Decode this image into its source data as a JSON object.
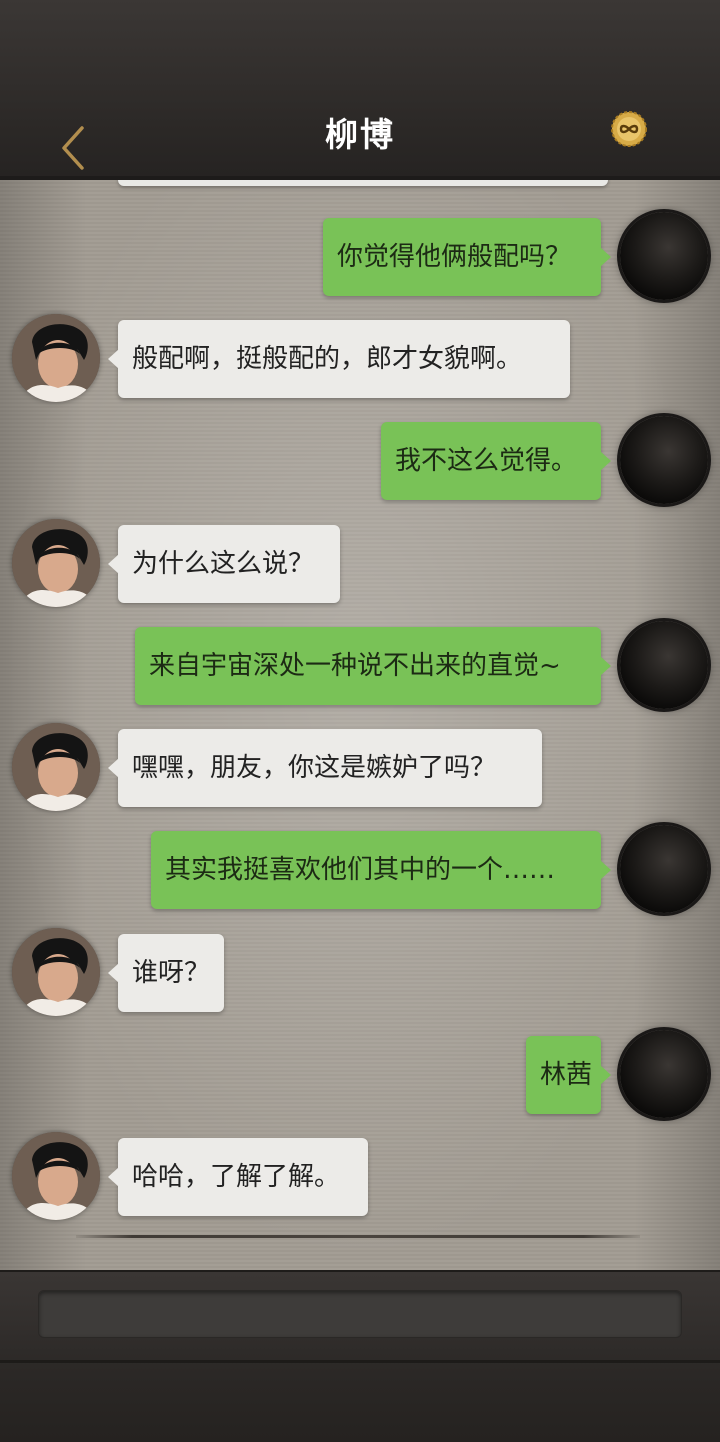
{
  "header": {
    "title": "柳博",
    "back_icon": "chevron-left-icon",
    "coin_icon": "infinity-coin-icon",
    "accent_color": "#c9a24b"
  },
  "chat": {
    "messages": [
      {
        "sender": "me",
        "text": "你觉得他俩般配吗？"
      },
      {
        "sender": "them",
        "text": "般配啊，挺般配的，郎才女貌啊。"
      },
      {
        "sender": "me",
        "text": "我不这么觉得。"
      },
      {
        "sender": "them",
        "text": "为什么这么说？"
      },
      {
        "sender": "me",
        "text": "来自宇宙深处一种说不出来的直觉~"
      },
      {
        "sender": "them",
        "text": "嘿嘿，朋友，你这是嫉妒了吗？"
      },
      {
        "sender": "me",
        "text": "其实我挺喜欢他们其中的一个……"
      },
      {
        "sender": "them",
        "text": "谁呀？"
      },
      {
        "sender": "me",
        "text": "林茜"
      },
      {
        "sender": "them",
        "text": "哈哈，了解了解。"
      }
    ],
    "colors": {
      "my_bubble": "#79c257",
      "their_bubble": "#ecebe8"
    }
  },
  "composer": {
    "value": ""
  }
}
